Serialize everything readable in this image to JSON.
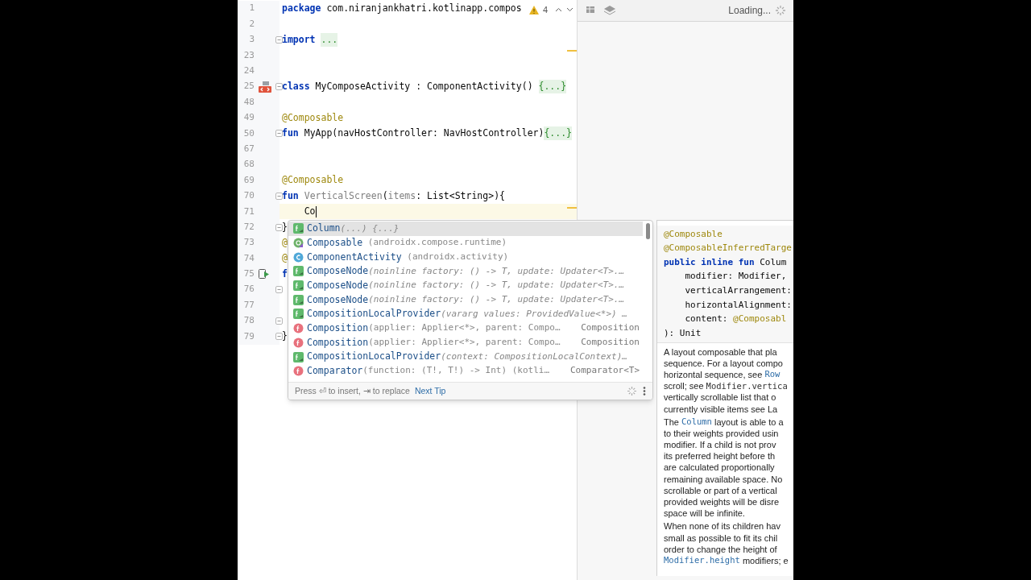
{
  "editor": {
    "inspections": {
      "count": "4"
    },
    "lines": [
      {
        "number": "1",
        "fold": false,
        "current": false,
        "segments": [
          {
            "kind": "keyword",
            "text": "package "
          },
          {
            "kind": "plain",
            "text": "com.niranjankhatri.kotlinapp.compos"
          }
        ]
      },
      {
        "number": "2",
        "fold": false,
        "current": false
      },
      {
        "number": "3",
        "fold": true,
        "current": false,
        "segments": [
          {
            "kind": "keyword",
            "text": "import "
          },
          {
            "kind": "folded",
            "text": "..."
          }
        ]
      },
      {
        "number": "23",
        "fold": false,
        "current": false
      },
      {
        "number": "24",
        "fold": false,
        "current": false
      },
      {
        "number": "25",
        "fold": true,
        "current": false,
        "gutter_icon": {
          "kind": "preview"
        },
        "segments": [
          {
            "kind": "keyword",
            "text": "class "
          },
          {
            "kind": "plain",
            "text": "MyComposeActivity : ComponentActivity() "
          },
          {
            "kind": "folded",
            "text": "{...}"
          }
        ]
      },
      {
        "number": "48",
        "fold": false,
        "current": false
      },
      {
        "number": "49",
        "fold": false,
        "current": false,
        "segments": [
          {
            "kind": "annotation",
            "text": "@Composable"
          }
        ]
      },
      {
        "number": "50",
        "fold": true,
        "current": false,
        "segments": [
          {
            "kind": "keyword",
            "text": "fun "
          },
          {
            "kind": "plain",
            "text": "MyApp(navHostController: NavHostController)"
          },
          {
            "kind": "folded",
            "text": "{...}"
          }
        ]
      },
      {
        "number": "67",
        "fold": false,
        "current": false
      },
      {
        "number": "68",
        "fold": false,
        "current": false
      },
      {
        "number": "69",
        "fold": false,
        "current": false,
        "segments": [
          {
            "kind": "annotation",
            "text": "@Composable"
          }
        ]
      },
      {
        "number": "70",
        "fold": true,
        "current": false,
        "segments": [
          {
            "kind": "keyword",
            "text": "fun "
          },
          {
            "kind": "unused",
            "text": "VerticalScreen"
          },
          {
            "kind": "plain",
            "text": "("
          },
          {
            "kind": "unused",
            "text": "items"
          },
          {
            "kind": "plain",
            "text": ": List<String>){"
          }
        ]
      },
      {
        "number": "71",
        "fold": false,
        "current": true,
        "caret": true,
        "segments": [
          {
            "kind": "plain",
            "text": "    Co"
          }
        ]
      },
      {
        "number": "72",
        "fold": true,
        "current": false,
        "segments": [
          {
            "kind": "plain",
            "text": "}"
          }
        ]
      },
      {
        "number": "73",
        "fold": false,
        "current": false,
        "segments": [
          {
            "kind": "annotation",
            "text": "@"
          }
        ]
      },
      {
        "number": "74",
        "fold": false,
        "current": false,
        "segments": [
          {
            "kind": "annotation",
            "text": "@"
          }
        ]
      },
      {
        "number": "75",
        "fold": false,
        "current": false,
        "gutter_icon": {
          "kind": "run"
        },
        "segments": [
          {
            "kind": "keyword",
            "text": "f"
          }
        ]
      },
      {
        "number": "76",
        "fold": true,
        "current": false
      },
      {
        "number": "77",
        "fold": false,
        "current": false
      },
      {
        "number": "78",
        "fold": true,
        "current": false
      },
      {
        "number": "79",
        "fold": true,
        "current": false,
        "segments": [
          {
            "kind": "plain",
            "text": "}"
          }
        ]
      }
    ]
  },
  "completion": {
    "items": [
      {
        "kind": "composable",
        "name": "Column",
        "signature": "(...) {...}",
        "italic": true,
        "selected": true
      },
      {
        "kind": "annotation",
        "name": "Composable",
        "signature": " (androidx.compose.runtime)",
        "italic": false,
        "selected": false
      },
      {
        "kind": "class",
        "name": "ComponentActivity",
        "signature": " (androidx.activity)",
        "italic": false,
        "selected": false
      },
      {
        "kind": "composable",
        "name": "ComposeNode",
        "signature": "(noinline factory: () -> T, update: Updater<T>.…",
        "italic": true,
        "selected": false
      },
      {
        "kind": "composable",
        "name": "ComposeNode",
        "signature": "(noinline factory: () -> T, update: Updater<T>.…",
        "italic": true,
        "selected": false
      },
      {
        "kind": "composable",
        "name": "ComposeNode",
        "signature": "(noinline factory: () -> T, update: Updater<T>.…",
        "italic": true,
        "selected": false
      },
      {
        "kind": "composable",
        "name": "CompositionLocalProvider",
        "signature": "(vararg values: ProvidedValue<*>) …",
        "italic": true,
        "selected": false
      },
      {
        "kind": "function",
        "name": "Composition",
        "signature": "(applier: Applier<*>, parent: Compo…",
        "type": "Composition",
        "italic": false,
        "selected": false
      },
      {
        "kind": "function",
        "name": "Composition",
        "signature": "(applier: Applier<*>, parent: Compo…",
        "type": "Composition",
        "italic": false,
        "selected": false
      },
      {
        "kind": "composable",
        "name": "CompositionLocalProvider",
        "signature": "(context: CompositionLocalContext)…",
        "italic": true,
        "selected": false
      },
      {
        "kind": "function",
        "name": "Comparator",
        "signature": "(function: (T!, T!) -> Int) (kotli…",
        "type": "Comparator<T>",
        "italic": false,
        "selected": false
      }
    ],
    "hint": "Press ⏎ to insert, ⇥ to replace",
    "next_tip": "Next Tip"
  },
  "preview": {
    "status": "Loading..."
  },
  "documentation": {
    "signature": [
      [
        {
          "kind": "annotation",
          "text": "@Composable"
        }
      ],
      [
        {
          "kind": "annotation",
          "text": "@ComposableInferredTarge"
        }
      ],
      [
        {
          "kind": "keyword",
          "text": "public inline fun "
        },
        {
          "kind": "plain",
          "text": "Colum"
        }
      ],
      [
        {
          "kind": "plain",
          "text": "    modifier: Modifier,"
        }
      ],
      [
        {
          "kind": "plain",
          "text": "    verticalArrangement:"
        }
      ],
      [
        {
          "kind": "plain",
          "text": "    horizontalAlignment:"
        }
      ],
      [
        {
          "kind": "plain",
          "text": "    content: "
        },
        {
          "kind": "annotation",
          "text": "@Composabl"
        }
      ],
      [
        {
          "kind": "plain",
          "text": "): Unit"
        }
      ]
    ],
    "paragraphs": [
      [
        [
          {
            "kind": "plain",
            "text": "A layout composable that pla"
          }
        ],
        [
          {
            "kind": "plain",
            "text": "sequence. For a layout compo"
          }
        ],
        [
          {
            "kind": "plain",
            "text": "horizontal sequence, see "
          },
          {
            "kind": "link",
            "text": "Row"
          }
        ],
        [
          {
            "kind": "plain",
            "text": "scroll; see "
          },
          {
            "kind": "code",
            "text": "Modifier.vertica"
          }
        ],
        [
          {
            "kind": "plain",
            "text": "vertically scrollable list that o"
          }
        ],
        [
          {
            "kind": "plain",
            "text": "currently visible items see La"
          }
        ]
      ],
      [
        [
          {
            "kind": "plain",
            "text": "The "
          },
          {
            "kind": "link",
            "text": "Column"
          },
          {
            "kind": "plain",
            "text": " layout is able to a"
          }
        ],
        [
          {
            "kind": "plain",
            "text": "to their weights provided usin"
          }
        ],
        [
          {
            "kind": "plain",
            "text": "modifier. If a child is not prov"
          }
        ],
        [
          {
            "kind": "plain",
            "text": "its preferred height before th"
          }
        ],
        [
          {
            "kind": "plain",
            "text": "are calculated proportionally"
          }
        ],
        [
          {
            "kind": "plain",
            "text": "remaining available space. No"
          }
        ],
        [
          {
            "kind": "plain",
            "text": "scrollable or part of a vertical"
          }
        ],
        [
          {
            "kind": "plain",
            "text": "provided weights will be disre"
          }
        ],
        [
          {
            "kind": "plain",
            "text": "space will be infinite."
          }
        ]
      ],
      [
        [
          {
            "kind": "plain",
            "text": "When none of its children hav"
          }
        ],
        [
          {
            "kind": "plain",
            "text": "small as possible to fit its chil"
          }
        ],
        [
          {
            "kind": "plain",
            "text": "order to change the height of"
          }
        ],
        [
          {
            "kind": "link",
            "text": "Modifier.height"
          },
          {
            "kind": "plain",
            "text": " modifiers; e"
          }
        ]
      ]
    ]
  }
}
